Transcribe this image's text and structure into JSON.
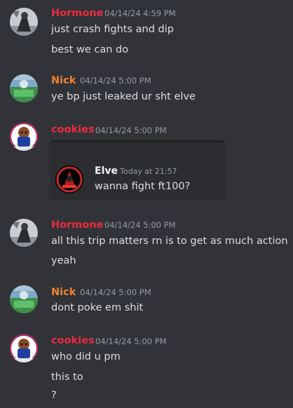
{
  "colors": {
    "background": "#313338",
    "hormone": "#ed2b3d",
    "nick": "#f0822f",
    "cookies": "#ed2b3d",
    "timestamp": "#949ba4",
    "text": "#dbdee1"
  },
  "messages": [
    {
      "author": "Hormone",
      "timestamp": "04/14/24 4:59 PM",
      "avatar": "hormone-avatar",
      "lines": [
        "just crash fights and dip",
        "best we can do"
      ]
    },
    {
      "author": "Nick",
      "timestamp": "04/14/24 5:00 PM",
      "avatar": "nick-avatar",
      "lines": [
        "ye bp just leaked ur sht elve"
      ]
    },
    {
      "author": "cookies",
      "timestamp": "04/14/24 5:00 PM",
      "avatar": "cookies-avatar",
      "embed": {
        "author": "Elve",
        "timestamp": "Today at 21:57",
        "text": "wanna fight ft100?"
      }
    },
    {
      "author": "Hormone",
      "timestamp": "04/14/24 5:00 PM",
      "avatar": "hormone-avatar",
      "lines": [
        "all this trip matters rn is to get as much action",
        "yeah"
      ]
    },
    {
      "author": "Nick",
      "timestamp": "04/14/24 5:00 PM",
      "avatar": "nick-avatar",
      "lines": [
        "dont poke em shit"
      ]
    },
    {
      "author": "cookies",
      "timestamp": "04/14/24 5:00 PM",
      "avatar": "cookies-avatar",
      "lines": [
        "who did u pm",
        "this to",
        "?"
      ]
    }
  ]
}
